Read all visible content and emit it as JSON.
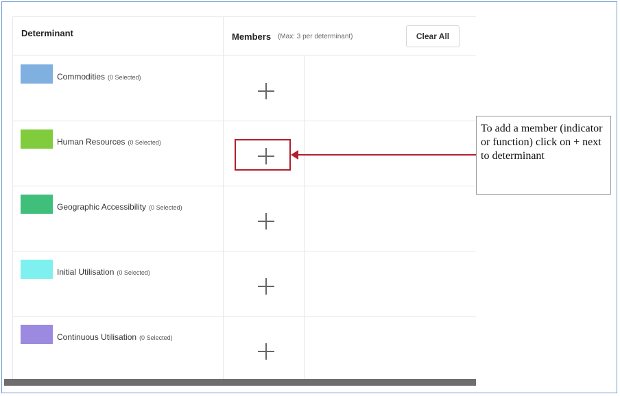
{
  "header": {
    "determinant_title": "Determinant",
    "members_title": "Members",
    "members_subtitle": "(Max: 3 per determinant)",
    "clear_all_label": "Clear All"
  },
  "rows": [
    {
      "label": "Commodities",
      "count": "(0 Selected)",
      "color": "#7fb0e0"
    },
    {
      "label": "Human Resources",
      "count": "(0 Selected)",
      "color": "#80cc3c"
    },
    {
      "label": "Geographic Accessibility",
      "count": "(0 Selected)",
      "color": "#3fbf7a"
    },
    {
      "label": "Initial Utilisation",
      "count": "(0 Selected)",
      "color": "#7ff0f0"
    },
    {
      "label": "Continuous Utilisation",
      "count": "(0 Selected)",
      "color": "#9c8ae0"
    }
  ],
  "annotation": {
    "callout_text": "To add a member (indicator or function) click on + next to determinant",
    "highlight_color": "#b0202a"
  },
  "icons": {
    "add": "plus-icon"
  }
}
